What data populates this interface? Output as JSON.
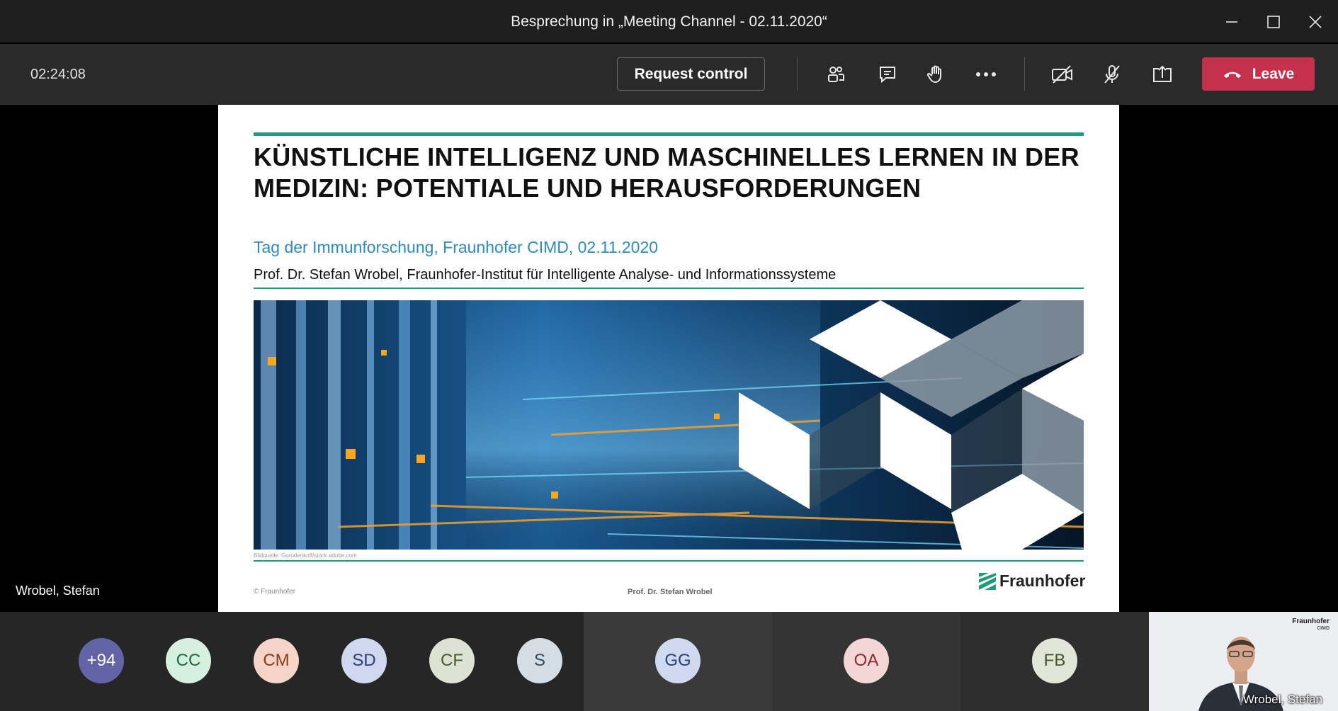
{
  "window": {
    "title": "Besprechung in „Meeting Channel - 02.11.2020“"
  },
  "controls": {
    "timer": "02:24:08",
    "request_control_label": "Request control",
    "leave_label": "Leave",
    "leave_color": "#c4314b"
  },
  "stage": {
    "presenter_name": "Wrobel, Stefan"
  },
  "slide": {
    "title": "KÜNSTLICHE INTELLIGENZ UND MASCHINELLES LERNEN IN DER MEDIZIN: POTENTIALE UND HERAUSFORDERUNGEN",
    "event": "Tag der Immunforschung, Fraunhofer CIMD, 02.11.2020",
    "author": "Prof. Dr. Stefan Wrobel, Fraunhofer-Institut für Intelligente Analyse- und Informationssysteme",
    "image_credit": "Bildquelle: Gorodenkoff/stock.adobe.com",
    "copyright": "© Fraunhofer",
    "footer_author": "Prof. Dr. Stefan Wrobel",
    "brand": "Fraunhofer",
    "accent_color": "#1f9a7a",
    "event_color": "#2d8bc2"
  },
  "participants": {
    "avatars": [
      {
        "initials": "+94",
        "bg": "#6264a7",
        "fg": "#ffffff"
      },
      {
        "initials": "CC",
        "bg": "#d6f0df",
        "fg": "#1a6b3a"
      },
      {
        "initials": "CM",
        "bg": "#f6d5c8",
        "fg": "#8a3a1e"
      },
      {
        "initials": "SD",
        "bg": "#cfd8ef",
        "fg": "#2a3f7a"
      },
      {
        "initials": "CF",
        "bg": "#dde3d3",
        "fg": "#4a5a30"
      },
      {
        "initials": "S",
        "bg": "#d3dde3",
        "fg": "#2f4b5c"
      },
      {
        "initials": "GG",
        "bg": "#cfd9ef",
        "fg": "#2a3f7a"
      },
      {
        "initials": "OA",
        "bg": "#f4d6d6",
        "fg": "#8a2a2a"
      },
      {
        "initials": "FB",
        "bg": "#e2e6d6",
        "fg": "#4a5530"
      }
    ],
    "video_name": "Wrobel, Stefan",
    "video_logo": "Fraunhofer",
    "video_logo_sub": "CIMD"
  }
}
